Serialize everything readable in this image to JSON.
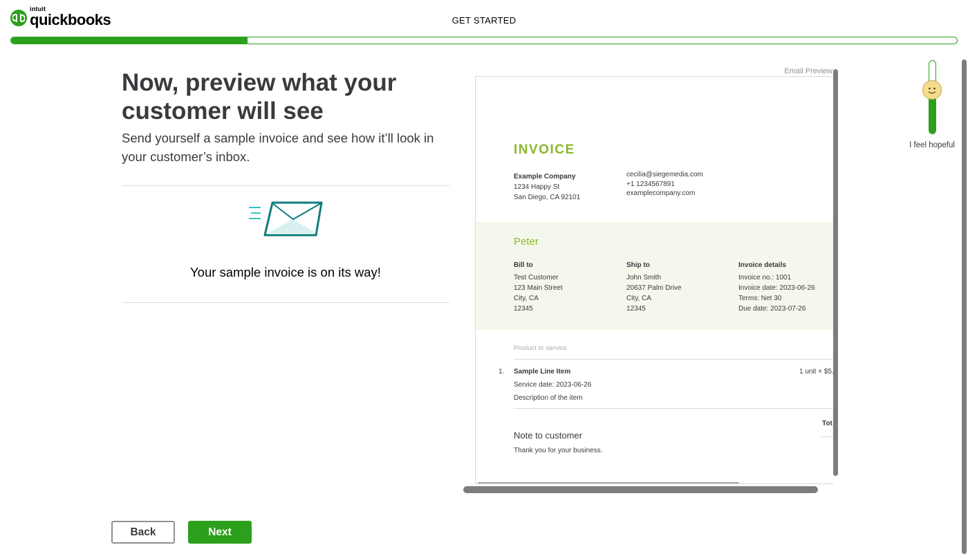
{
  "header": {
    "logo_brand": "intuit",
    "logo_name": "quickbooks",
    "title": "GET STARTED",
    "progress_fraction": 0.25
  },
  "main": {
    "headline": "Now, preview what your customer will see",
    "subtext": "Send yourself a sample invoice and see how it’ll look in your customer’s inbox.",
    "sent_message": "Your sample invoice is on its way!"
  },
  "preview": {
    "label": "Email Preview",
    "invoice_title": "INVOICE",
    "company": {
      "name": "Example Company",
      "street": "1234 Happy St",
      "city": "San Diego, CA 92101"
    },
    "contact": {
      "email": "cecilia@siegemedia.com",
      "phone": "+1 1234567891",
      "website": "examplecompany.com"
    },
    "customer_name": "Peter",
    "bill_to": {
      "heading": "Bill to",
      "name": "Test Customer",
      "street": "123 Main Street",
      "city": "City, CA",
      "zip": "12345"
    },
    "ship_to": {
      "heading": "Ship to",
      "name": "John Smith",
      "street": "20637 Palm Drive",
      "city": "City, CA",
      "zip": "12345"
    },
    "invoice_details": {
      "heading": "Invoice details",
      "number": "Invoice no.: 1001",
      "date": "Invoice date: 2023-06-26",
      "terms": "Terms: Net 30",
      "due": "Due date: 2023-07-26"
    },
    "product_header": "Product or service",
    "line_item": {
      "number": "1.",
      "name": "Sample Line Item",
      "service_date": "Service date: 2023-06-26",
      "description": "Description of the item",
      "quantity_price": "1 unit × $5."
    },
    "total_label": "Tot",
    "note_title": "Note to customer",
    "note_text": "Thank you for your business."
  },
  "mood": {
    "label": "I feel hopeful",
    "level_fraction": 0.72
  },
  "footer": {
    "back_label": "Back",
    "next_label": "Next"
  },
  "colors": {
    "brand_green": "#2ca01c",
    "invoice_green": "#8cb82b",
    "band_bg": "#f4f8ec",
    "envelope_teal": "#0e7c7b"
  }
}
